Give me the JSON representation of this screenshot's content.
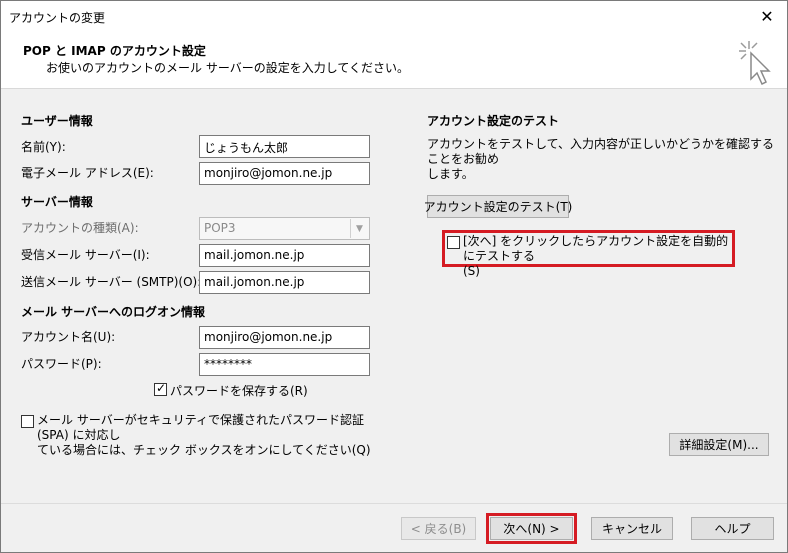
{
  "window": {
    "title": "アカウントの変更"
  },
  "header": {
    "title": "POP と IMAP のアカウント設定",
    "subtitle": "お使いのアカウントのメール サーバーの設定を入力してください。"
  },
  "user_info": {
    "section": "ユーザー情報",
    "name_label": "名前(Y):",
    "name_value": "じょうもん太郎",
    "email_label": "電子メール アドレス(E):",
    "email_value": "monjiro@jomon.ne.jp"
  },
  "server_info": {
    "section": "サーバー情報",
    "type_label": "アカウントの種類(A):",
    "type_value": "POP3",
    "incoming_label": "受信メール サーバー(I):",
    "incoming_value": "mail.jomon.ne.jp",
    "outgoing_label": "送信メール サーバー (SMTP)(O):",
    "outgoing_value": "mail.jomon.ne.jp"
  },
  "logon_info": {
    "section": "メール サーバーへのログオン情報",
    "account_label": "アカウント名(U):",
    "account_value": "monjiro@jomon.ne.jp",
    "password_label": "パスワード(P):",
    "password_value": "********",
    "save_password_label": "パスワードを保存する(R)",
    "spa_label_line1": "メール サーバーがセキュリティで保護されたパスワード認証 (SPA) に対応し",
    "spa_label_line2": "ている場合には、チェック ボックスをオンにしてください(Q)"
  },
  "test_section": {
    "title": "アカウント設定のテスト",
    "desc_line1": "アカウントをテストして、入力内容が正しいかどうかを確認することをお勧め",
    "desc_line2": "します。",
    "test_button": "アカウント設定のテスト(T)",
    "auto_test_line1": "[次へ] をクリックしたらアカウント設定を自動的にテストする",
    "auto_test_line2": "(S)"
  },
  "buttons": {
    "more_settings": "詳細設定(M)...",
    "back": "< 戻る(B)",
    "next": "次へ(N) >",
    "cancel": "キャンセル",
    "help": "ヘルプ"
  },
  "colors": {
    "highlight": "#d51b23"
  }
}
